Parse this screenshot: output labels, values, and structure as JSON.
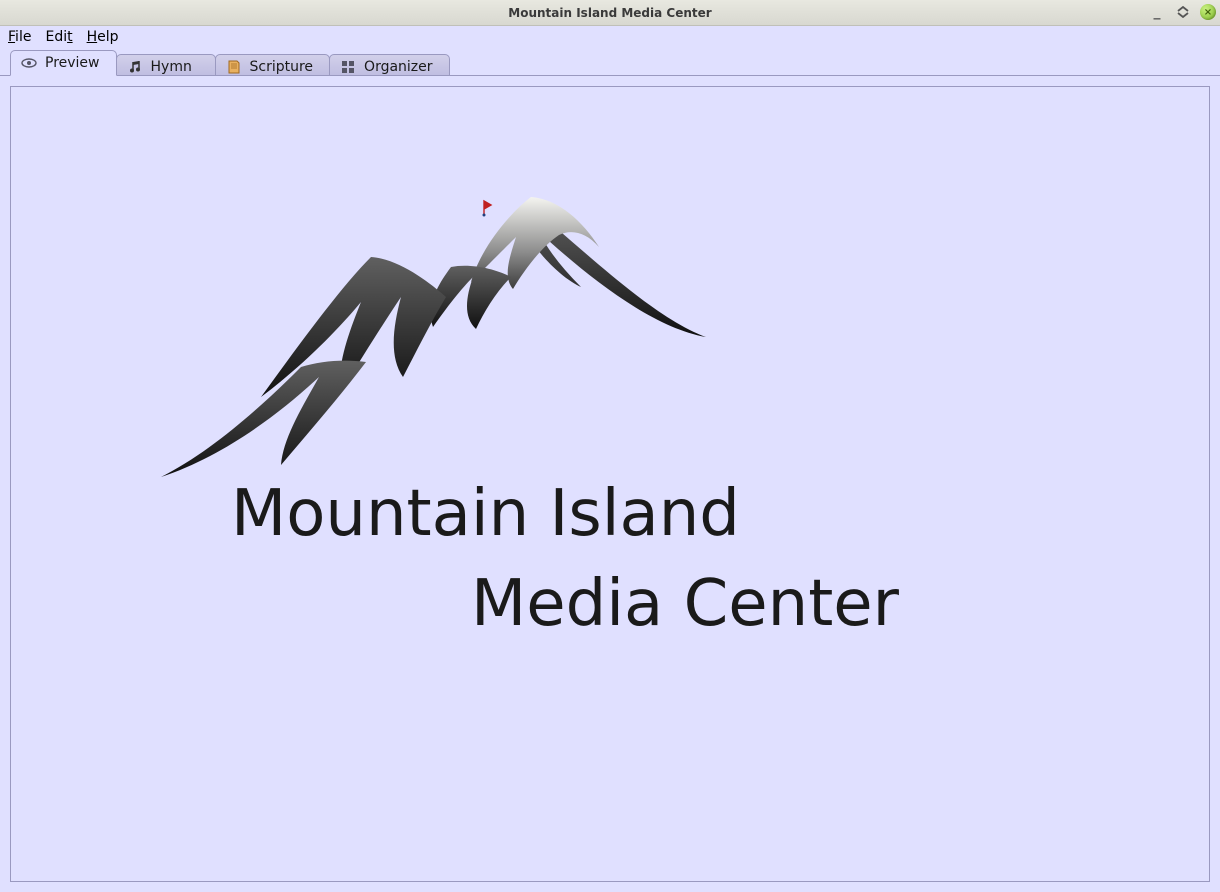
{
  "window": {
    "title": "Mountain Island Media Center"
  },
  "menubar": {
    "file": "File",
    "edit": "Edit",
    "help": "Help"
  },
  "tabs": [
    {
      "label": "Preview",
      "icon": "eye-icon",
      "active": true
    },
    {
      "label": "Hymn",
      "icon": "music-note-icon",
      "active": false
    },
    {
      "label": "Scripture",
      "icon": "book-icon",
      "active": false
    },
    {
      "label": "Organizer",
      "icon": "grid-icon",
      "active": false
    }
  ],
  "preview": {
    "logo_line1": "Mountain Island",
    "logo_line2": "Media Center"
  }
}
